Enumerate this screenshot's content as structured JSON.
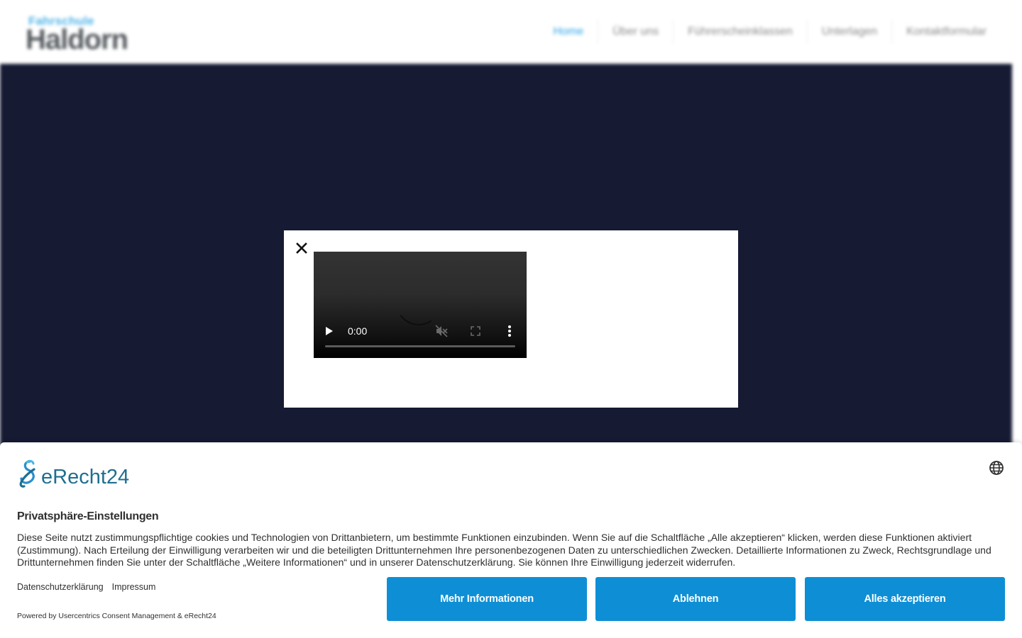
{
  "site": {
    "logo_top": "Fahrschule",
    "logo_main": "Haldorn",
    "nav": [
      {
        "label": "Home",
        "active": true
      },
      {
        "label": "Über uns",
        "active": false
      },
      {
        "label": "Führerscheinklassen",
        "active": false
      },
      {
        "label": "Unterlagen",
        "active": false
      },
      {
        "label": "Kontaktformular",
        "active": false
      }
    ],
    "hero_color": "#161a33"
  },
  "modal": {
    "close_icon": "close-icon",
    "video": {
      "time": "0:00",
      "progress": 0,
      "play_icon": "play-icon",
      "mute_icon": "muted-icon",
      "fullscreen_icon": "fullscreen-icon",
      "more_icon": "more-vertical-icon"
    }
  },
  "consent": {
    "brand": "eRecht24",
    "language_icon": "globe-icon",
    "title": "Privatsphäre-Einstellungen",
    "text": "Diese Seite nutzt zustimmungspflichtige cookies und Technologien von Drittanbietern, um bestimmte Funktionen einzubinden. Wenn Sie auf die Schaltfläche „Alle akzeptieren“ klicken, werden diese Funktionen aktiviert (Zustimmung). Nach Erteilung der Einwilligung verarbeiten wir und die beteiligten Drittunternehmen Ihre personenbezogenen Daten zu unterschiedlichen Zwecken. Detaillierte Informationen zu Zweck, Rechtsgrundlage und Drittunternehmen finden Sie unter der Schaltfläche „Weitere Informationen“ und in unserer Datenschutzerklärung. Sie können Ihre Einwilligung jederzeit widerrufen.",
    "links": {
      "privacy": "Datenschutzerklärung",
      "imprint": "Impressum"
    },
    "powered_by": "Powered by Usercentrics Consent Management & eRecht24",
    "buttons": {
      "more_info": "Mehr Informationen",
      "deny": "Ablehnen",
      "accept_all": "Alles akzeptieren"
    },
    "accent_color": "#0e8fd5"
  }
}
